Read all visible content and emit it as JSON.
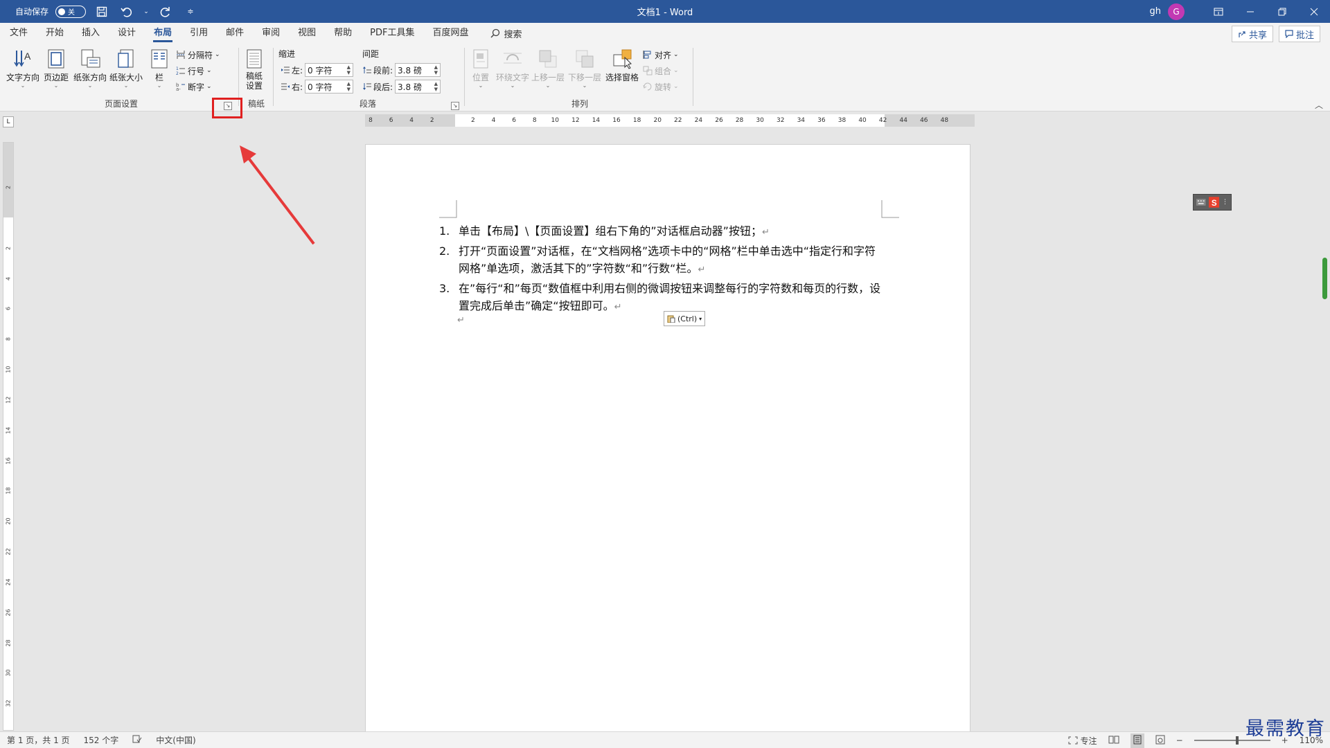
{
  "titlebar": {
    "autosave_label": "自动保存",
    "autosave_state": "关",
    "title": "文档1  -  Word",
    "user": "gh",
    "avatar_letter": "G"
  },
  "tabs": [
    {
      "label": "文件"
    },
    {
      "label": "开始"
    },
    {
      "label": "插入"
    },
    {
      "label": "设计"
    },
    {
      "label": "布局",
      "active": true
    },
    {
      "label": "引用"
    },
    {
      "label": "邮件"
    },
    {
      "label": "审阅"
    },
    {
      "label": "视图"
    },
    {
      "label": "帮助"
    },
    {
      "label": "PDF工具集"
    },
    {
      "label": "百度网盘"
    }
  ],
  "search_label": "搜索",
  "share_label": "共享",
  "comment_label": "批注",
  "ribbon": {
    "page_setup": {
      "label": "页面设置",
      "text_direction": "文字方向",
      "margins": "页边距",
      "orientation": "纸张方向",
      "size": "纸张大小",
      "columns": "栏",
      "breaks": "分隔符",
      "line_numbers": "行号",
      "hyphenation": "断字"
    },
    "manuscript": {
      "label": "稿纸",
      "button": "稿纸\n设置"
    },
    "paragraph": {
      "label": "段落",
      "indent_heading": "缩进",
      "spacing_heading": "间距",
      "left_label": "左:",
      "right_label": "右:",
      "before_label": "段前:",
      "after_label": "段后:",
      "left_value": "0 字符",
      "right_value": "0 字符",
      "before_value": "3.8 磅",
      "after_value": "3.8 磅"
    },
    "arrange": {
      "label": "排列",
      "position": "位置",
      "wrap_text": "环绕文字",
      "bring_forward": "上移一层",
      "send_backward": "下移一层",
      "selection_pane": "选择窗格",
      "align": "对齐",
      "group": "组合",
      "rotate": "旋转"
    }
  },
  "ruler_ticks": [
    "8",
    "6",
    "4",
    "2",
    "",
    "2",
    "4",
    "6",
    "8",
    "10",
    "12",
    "14",
    "16",
    "18",
    "20",
    "22",
    "24",
    "26",
    "28",
    "30",
    "32",
    "34",
    "36",
    "38",
    "40",
    "42",
    "44",
    "46",
    "48"
  ],
  "vruler_ticks": [
    "2",
    "",
    "2",
    "4",
    "6",
    "8",
    "10",
    "12",
    "14",
    "16",
    "18",
    "20",
    "22",
    "24",
    "26",
    "28",
    "30",
    "32"
  ],
  "document": {
    "items": [
      {
        "num": "1.",
        "text": "单击【布局】\\【页面设置】组右下角的”对话框启动器”按钮；"
      },
      {
        "num": "2.",
        "text": "打开“页面设置”对话框，在“文档网格”选项卡中的“网格”栏中单击选中“指定行和字符网格”单选项，激活其下的”字符数“和”行数“栏。"
      },
      {
        "num": "3.",
        "text": "在”每行“和”每页“数值框中利用右侧的微调按钮来调整每行的字符数和每页的行数，设置完成后单击”确定“按钮即可。"
      }
    ],
    "pilcrow": "↵",
    "paste_label": "(Ctrl)"
  },
  "status": {
    "page": "第 1 页，共 1 页",
    "words": "152 个字",
    "language": "中文(中国)",
    "focus": "专注",
    "zoom": "110%"
  },
  "watermark": "最需教育",
  "colors": {
    "title_bar": "#2b579a",
    "accent": "#2b579a",
    "highlight": "#e02020",
    "avatar": "#c239b3"
  }
}
